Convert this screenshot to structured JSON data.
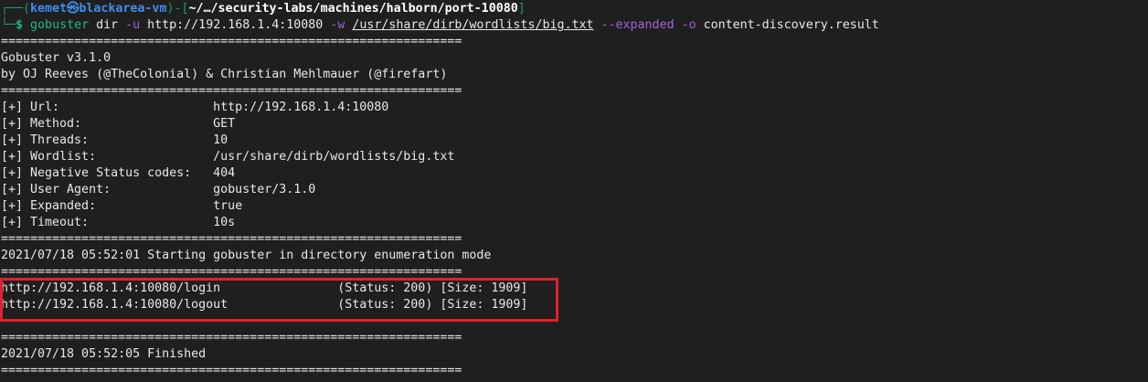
{
  "prompt": {
    "user": "kemet",
    "host": "blackarea-vm",
    "cwd": "~/…/security-labs/machines/halborn/port-10080",
    "symbol": "$",
    "command": "gobuster",
    "args": [
      {
        "text": " dir ",
        "style": ""
      },
      {
        "text": "-u",
        "style": "purple"
      },
      {
        "text": " http://192.168.1.4:10080 ",
        "style": ""
      },
      {
        "text": "-w",
        "style": "purple"
      },
      {
        "text": " ",
        "style": ""
      },
      {
        "text": "/usr/share/dirb/wordlists/big.txt",
        "style": "ul"
      },
      {
        "text": " ",
        "style": ""
      },
      {
        "text": "--expanded",
        "style": "purple"
      },
      {
        "text": " ",
        "style": ""
      },
      {
        "text": "-o",
        "style": "purple"
      },
      {
        "text": " content-discovery.result",
        "style": ""
      }
    ]
  },
  "output": [
    "===============================================================",
    "Gobuster v3.1.0",
    "by OJ Reeves (@TheColonial) & Christian Mehlmauer (@firefart)",
    "===============================================================",
    "[+] Url:                     http://192.168.1.4:10080",
    "[+] Method:                  GET",
    "[+] Threads:                 10",
    "[+] Wordlist:                /usr/share/dirb/wordlists/big.txt",
    "[+] Negative Status codes:   404",
    "[+] User Agent:              gobuster/3.1.0",
    "[+] Expanded:                true",
    "[+] Timeout:                 10s",
    "===============================================================",
    "2021/07/18 05:52:01 Starting gobuster in directory enumeration mode",
    "===============================================================",
    "http://192.168.1.4:10080/login                (Status: 200) [Size: 1909]",
    "http://192.168.1.4:10080/logout               (Status: 200) [Size: 1909]",
    "",
    "===============================================================",
    "2021/07/18 05:52:05 Finished",
    "==============================================================="
  ],
  "colors": {
    "highlight": "#e3212b",
    "background": "#1f1f1f"
  }
}
